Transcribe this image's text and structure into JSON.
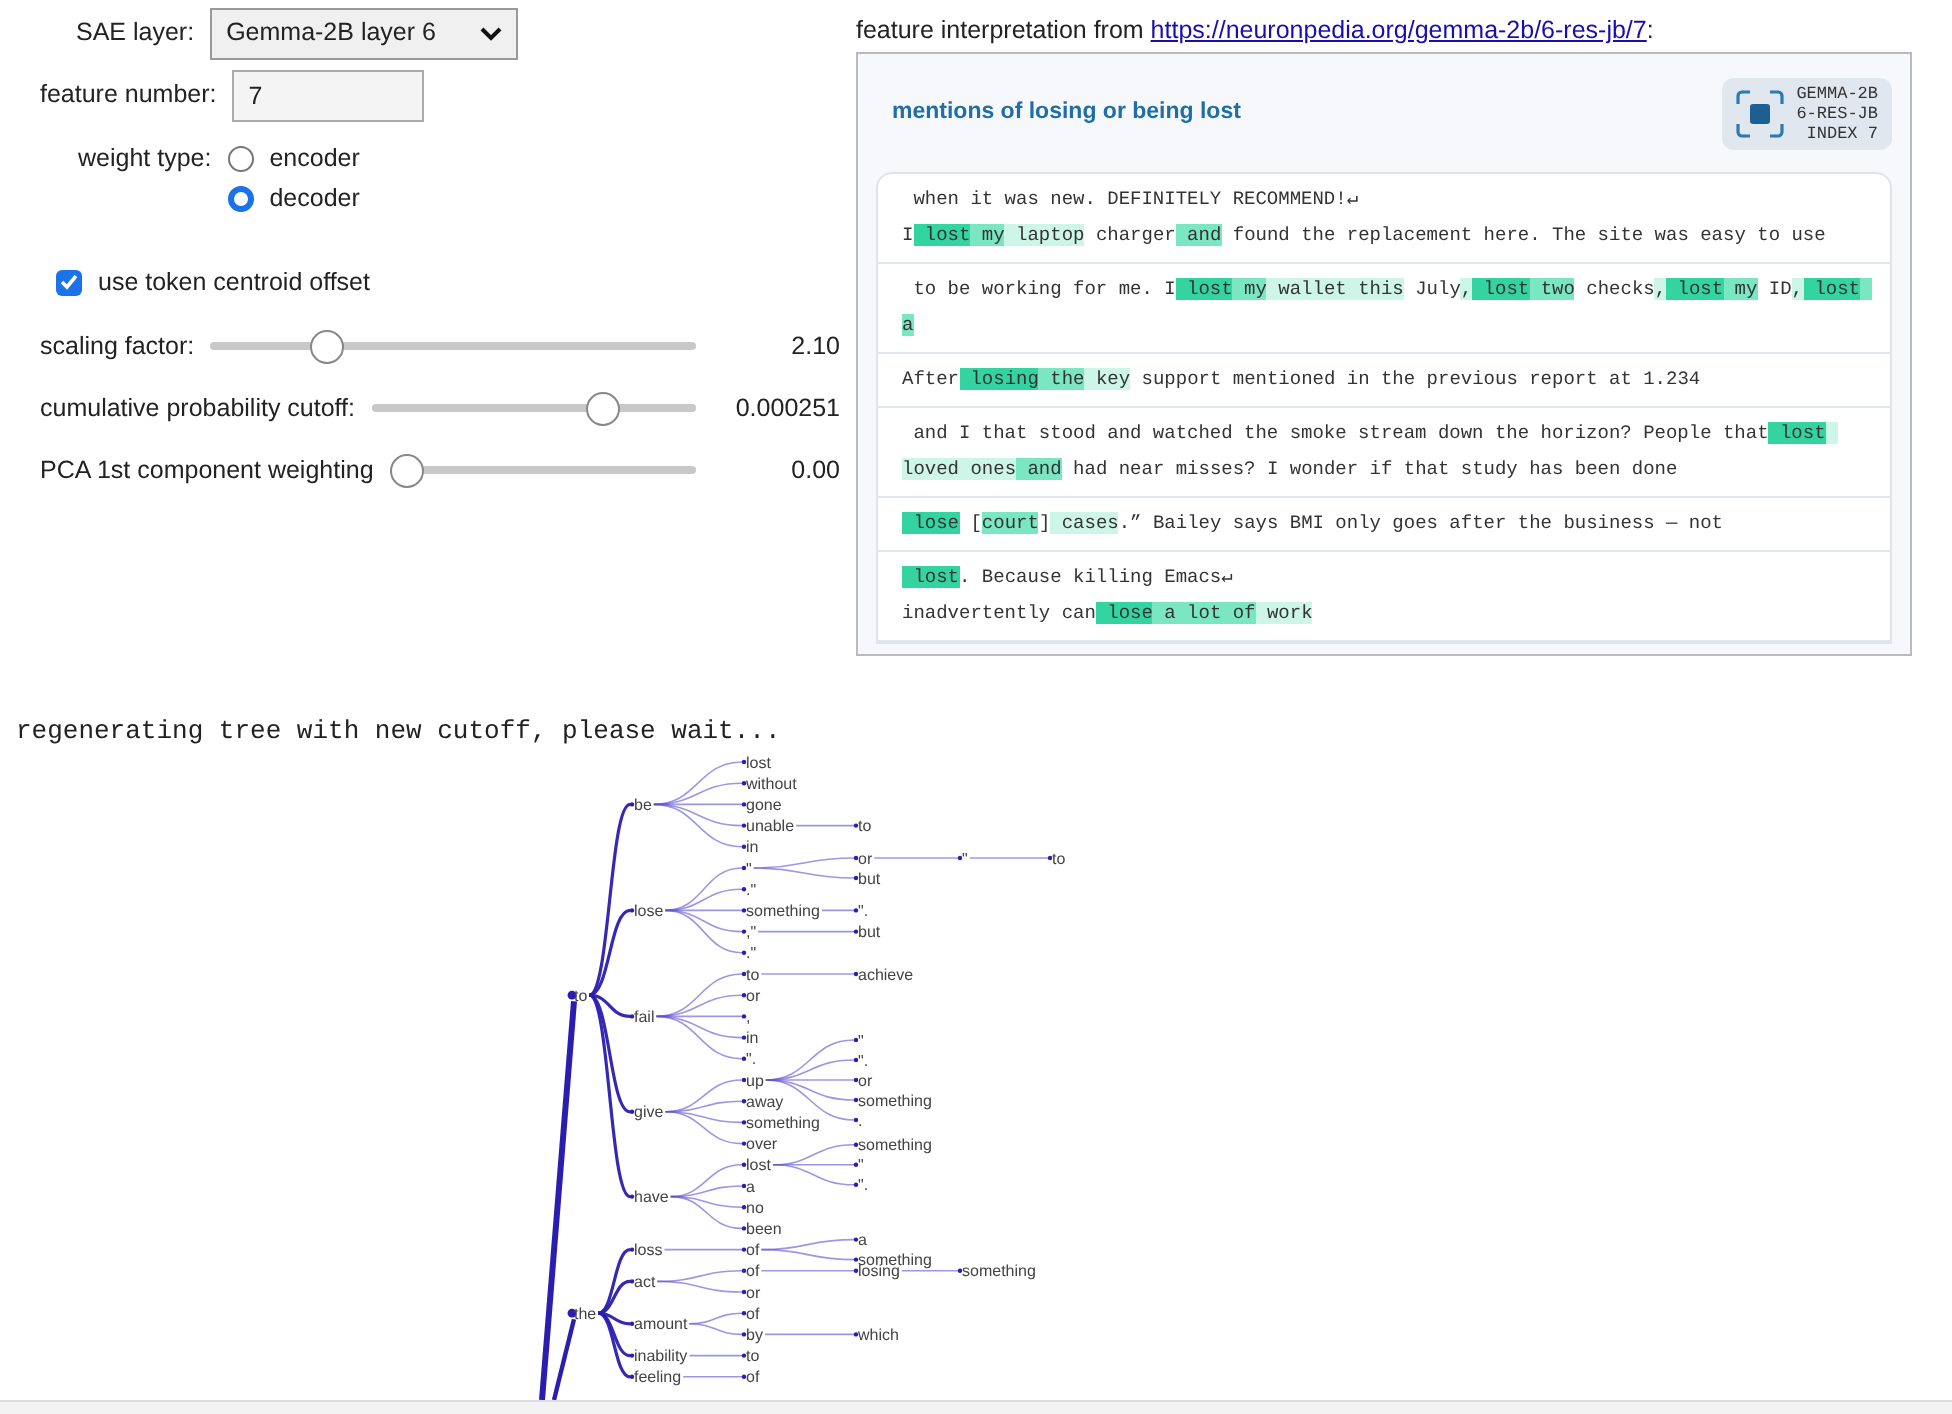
{
  "controls": {
    "sae_layer": {
      "label": "SAE layer:",
      "value": "Gemma-2B layer 6"
    },
    "feature_number": {
      "label": "feature number:",
      "value": "7"
    },
    "weight_type": {
      "label": "weight type:",
      "options": [
        {
          "label": "encoder",
          "selected": false
        },
        {
          "label": "decoder",
          "selected": true
        }
      ]
    },
    "centroid_offset": {
      "label": "use token centroid offset",
      "checked": true
    },
    "sliders": [
      {
        "label": "scaling factor:",
        "level": 0.22,
        "reading": "2.10"
      },
      {
        "label": "cumulative probability cutoff:",
        "level": 0.74,
        "reading": "0.000251"
      },
      {
        "label": "PCA 1st component weighting",
        "level": 0.0,
        "reading": "0.00"
      }
    ]
  },
  "feature_panel": {
    "caption": "feature interpretation from",
    "link": "https://neuronpedia.org/gemma-2b/6-res-jb/7",
    "caption_end": ":",
    "title": "mentions of losing or being lost",
    "badge": [
      "GEMMA-2B",
      "6-RES-JB",
      "INDEX 7"
    ],
    "examples": [
      {
        "segments": [
          {
            "text": " when it was new. DEFINITELY RECOMMEND!↵\nI"
          },
          {
            "text": " lost",
            "color": "#34d4a0"
          },
          {
            "text": " my",
            "color": "#7ae6c2"
          },
          {
            "text": " laptop",
            "color": "#cdf6e8"
          },
          {
            "text": " charger"
          },
          {
            "text": " and",
            "color": "#7ae6c2"
          },
          {
            "text": " found the replacement here. The site was easy to use"
          }
        ]
      },
      {
        "segments": [
          {
            "text": " to be working for me. I"
          },
          {
            "text": " lost",
            "color": "#34d4a0"
          },
          {
            "text": " my",
            "color": "#7ae6c2"
          },
          {
            "text": " wallet",
            "color": "#cdf6e8"
          },
          {
            "text": " this",
            "color": "#cdf6e8"
          },
          {
            "text": " July"
          },
          {
            "text": ",",
            "color": "#cdf6e8"
          },
          {
            "text": " lost",
            "color": "#34d4a0"
          },
          {
            "text": " two",
            "color": "#7ae6c2"
          },
          {
            "text": " checks"
          },
          {
            "text": ",",
            "color": "#cdf6e8"
          },
          {
            "text": " lost",
            "color": "#34d4a0"
          },
          {
            "text": " my",
            "color": "#7ae6c2"
          },
          {
            "text": " ID"
          },
          {
            "text": ",",
            "color": "#cdf6e8"
          },
          {
            "text": " lost",
            "color": "#34d4a0"
          },
          {
            "text": " a",
            "color": "#7ae6c2"
          }
        ]
      },
      {
        "segments": [
          {
            "text": "After"
          },
          {
            "text": " losing",
            "color": "#34d4a0"
          },
          {
            "text": " the",
            "color": "#7ae6c2"
          },
          {
            "text": " key",
            "color": "#cdf6e8"
          },
          {
            "text": " support mentioned in the previous report at 1.234"
          }
        ]
      },
      {
        "segments": [
          {
            "text": " and I that stood and watched the smoke stream down the horizon? People that"
          },
          {
            "text": " lost",
            "color": "#34d4a0"
          },
          {
            "text": " loved",
            "color": "#cdf6e8"
          },
          {
            "text": " ones",
            "color": "#cdf6e8"
          },
          {
            "text": " and",
            "color": "#7ae6c2"
          },
          {
            "text": " had near misses? I wonder if that study has been done"
          }
        ]
      },
      {
        "segments": [
          {
            "text": " lose",
            "color": "#34d4a0"
          },
          {
            "text": " ["
          },
          {
            "text": "court",
            "color": "#7ae6c2"
          },
          {
            "text": "]"
          },
          {
            "text": " cases",
            "color": "#cdf6e8"
          },
          {
            "text": ".” Bailey says BMI only goes after the business — not"
          }
        ]
      },
      {
        "segments": [
          {
            "text": " lost",
            "color": "#34d4a0"
          },
          {
            "text": ". Because killing Emacs↵\ninadvertently can"
          },
          {
            "text": " lose",
            "color": "#34d4a0"
          },
          {
            "text": " a",
            "color": "#7ae6c2"
          },
          {
            "text": " lot",
            "color": "#7ae6c2"
          },
          {
            "text": " of",
            "color": "#7ae6c2"
          },
          {
            "text": " work",
            "color": "#cdf6e8"
          }
        ]
      }
    ]
  },
  "status_message": "regenerating tree with new cutoff, please wait...",
  "tree": {
    "nodes": [
      {
        "label": "to",
        "children": [
          {
            "label": "be",
            "children": [
              {
                "label": "lost"
              },
              {
                "label": "without"
              },
              {
                "label": "gone"
              },
              {
                "label": "unable",
                "children": [
                  {
                    "label": "to"
                  }
                ]
              },
              {
                "label": "in"
              }
            ]
          },
          {
            "label": "lose",
            "children": [
              {
                "label": "\"",
                "children": [
                  {
                    "label": "or",
                    "children": [
                      {
                        "label": "\"",
                        "children": [
                          {
                            "label": "to"
                          }
                        ]
                      }
                    ]
                  },
                  {
                    "label": "but"
                  }
                ]
              },
              {
                "label": ".\""
              },
              {
                "label": "something",
                "children": [
                  {
                    "label": "\"."
                  }
                ]
              },
              {
                "label": ",\"",
                "children": [
                  {
                    "label": "but"
                  }
                ]
              },
              {
                "label": ".\""
              }
            ]
          },
          {
            "label": "fail",
            "children": [
              {
                "label": "to",
                "children": [
                  {
                    "label": "achieve"
                  }
                ]
              },
              {
                "label": "or"
              },
              {
                "label": ","
              },
              {
                "label": "in"
              },
              {
                "label": "\"."
              }
            ]
          },
          {
            "label": "give",
            "children": [
              {
                "label": "up",
                "children": [
                  {
                    "label": "\""
                  },
                  {
                    "label": "\"."
                  },
                  {
                    "label": "or"
                  },
                  {
                    "label": "something"
                  },
                  {
                    "label": "."
                  }
                ]
              },
              {
                "label": "away"
              },
              {
                "label": "something"
              },
              {
                "label": "over"
              }
            ]
          },
          {
            "label": "have",
            "children": [
              {
                "label": "lost",
                "children": [
                  {
                    "label": "something"
                  },
                  {
                    "label": "\""
                  },
                  {
                    "label": "\"."
                  }
                ]
              },
              {
                "label": "a"
              },
              {
                "label": "no"
              },
              {
                "label": "been"
              }
            ]
          }
        ]
      },
      {
        "label": "the",
        "children": [
          {
            "label": "loss",
            "children": [
              {
                "label": "of",
                "children": [
                  {
                    "label": "a"
                  },
                  {
                    "label": "something"
                  }
                ]
              }
            ]
          },
          {
            "label": "act",
            "children": [
              {
                "label": "of",
                "children": [
                  {
                    "label": "losing",
                    "children": [
                      {
                        "label": "something"
                      }
                    ]
                  }
                ]
              },
              {
                "label": "or"
              }
            ]
          },
          {
            "label": "amount",
            "children": [
              {
                "label": "of"
              },
              {
                "label": "by",
                "children": [
                  {
                    "label": "which"
                  }
                ]
              }
            ]
          },
          {
            "label": "inability",
            "children": [
              {
                "label": "to"
              }
            ]
          },
          {
            "label": "feeling",
            "children": [
              {
                "label": "of"
              }
            ]
          }
        ]
      }
    ]
  }
}
